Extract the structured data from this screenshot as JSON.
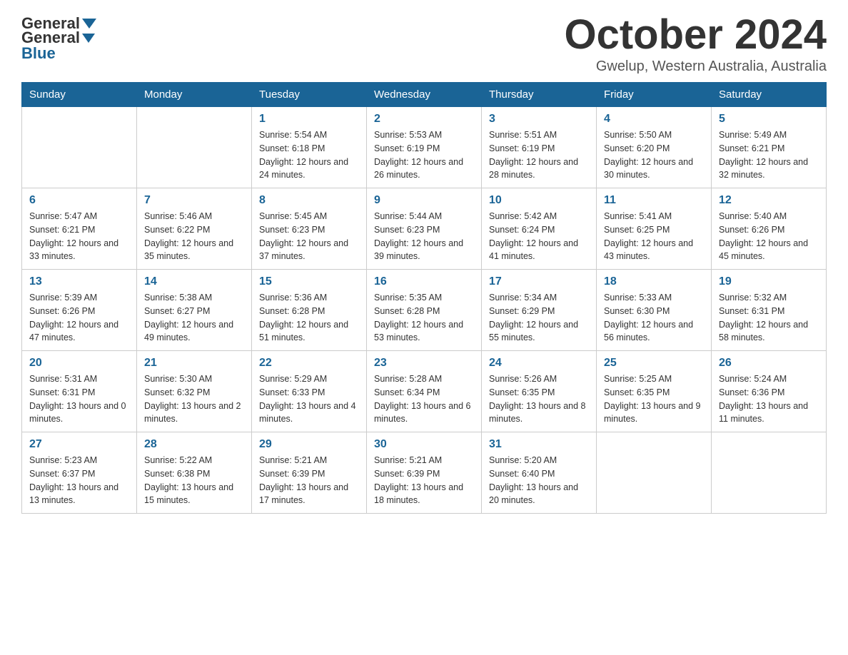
{
  "header": {
    "logo": {
      "part1": "General",
      "part2": "Blue"
    },
    "title": "October 2024",
    "location": "Gwelup, Western Australia, Australia"
  },
  "weekdays": [
    "Sunday",
    "Monday",
    "Tuesday",
    "Wednesday",
    "Thursday",
    "Friday",
    "Saturday"
  ],
  "weeks": [
    [
      {
        "day": "",
        "info": ""
      },
      {
        "day": "",
        "info": ""
      },
      {
        "day": "1",
        "info": "Sunrise: 5:54 AM\nSunset: 6:18 PM\nDaylight: 12 hours\nand 24 minutes."
      },
      {
        "day": "2",
        "info": "Sunrise: 5:53 AM\nSunset: 6:19 PM\nDaylight: 12 hours\nand 26 minutes."
      },
      {
        "day": "3",
        "info": "Sunrise: 5:51 AM\nSunset: 6:19 PM\nDaylight: 12 hours\nand 28 minutes."
      },
      {
        "day": "4",
        "info": "Sunrise: 5:50 AM\nSunset: 6:20 PM\nDaylight: 12 hours\nand 30 minutes."
      },
      {
        "day": "5",
        "info": "Sunrise: 5:49 AM\nSunset: 6:21 PM\nDaylight: 12 hours\nand 32 minutes."
      }
    ],
    [
      {
        "day": "6",
        "info": "Sunrise: 5:47 AM\nSunset: 6:21 PM\nDaylight: 12 hours\nand 33 minutes."
      },
      {
        "day": "7",
        "info": "Sunrise: 5:46 AM\nSunset: 6:22 PM\nDaylight: 12 hours\nand 35 minutes."
      },
      {
        "day": "8",
        "info": "Sunrise: 5:45 AM\nSunset: 6:23 PM\nDaylight: 12 hours\nand 37 minutes."
      },
      {
        "day": "9",
        "info": "Sunrise: 5:44 AM\nSunset: 6:23 PM\nDaylight: 12 hours\nand 39 minutes."
      },
      {
        "day": "10",
        "info": "Sunrise: 5:42 AM\nSunset: 6:24 PM\nDaylight: 12 hours\nand 41 minutes."
      },
      {
        "day": "11",
        "info": "Sunrise: 5:41 AM\nSunset: 6:25 PM\nDaylight: 12 hours\nand 43 minutes."
      },
      {
        "day": "12",
        "info": "Sunrise: 5:40 AM\nSunset: 6:26 PM\nDaylight: 12 hours\nand 45 minutes."
      }
    ],
    [
      {
        "day": "13",
        "info": "Sunrise: 5:39 AM\nSunset: 6:26 PM\nDaylight: 12 hours\nand 47 minutes."
      },
      {
        "day": "14",
        "info": "Sunrise: 5:38 AM\nSunset: 6:27 PM\nDaylight: 12 hours\nand 49 minutes."
      },
      {
        "day": "15",
        "info": "Sunrise: 5:36 AM\nSunset: 6:28 PM\nDaylight: 12 hours\nand 51 minutes."
      },
      {
        "day": "16",
        "info": "Sunrise: 5:35 AM\nSunset: 6:28 PM\nDaylight: 12 hours\nand 53 minutes."
      },
      {
        "day": "17",
        "info": "Sunrise: 5:34 AM\nSunset: 6:29 PM\nDaylight: 12 hours\nand 55 minutes."
      },
      {
        "day": "18",
        "info": "Sunrise: 5:33 AM\nSunset: 6:30 PM\nDaylight: 12 hours\nand 56 minutes."
      },
      {
        "day": "19",
        "info": "Sunrise: 5:32 AM\nSunset: 6:31 PM\nDaylight: 12 hours\nand 58 minutes."
      }
    ],
    [
      {
        "day": "20",
        "info": "Sunrise: 5:31 AM\nSunset: 6:31 PM\nDaylight: 13 hours\nand 0 minutes."
      },
      {
        "day": "21",
        "info": "Sunrise: 5:30 AM\nSunset: 6:32 PM\nDaylight: 13 hours\nand 2 minutes."
      },
      {
        "day": "22",
        "info": "Sunrise: 5:29 AM\nSunset: 6:33 PM\nDaylight: 13 hours\nand 4 minutes."
      },
      {
        "day": "23",
        "info": "Sunrise: 5:28 AM\nSunset: 6:34 PM\nDaylight: 13 hours\nand 6 minutes."
      },
      {
        "day": "24",
        "info": "Sunrise: 5:26 AM\nSunset: 6:35 PM\nDaylight: 13 hours\nand 8 minutes."
      },
      {
        "day": "25",
        "info": "Sunrise: 5:25 AM\nSunset: 6:35 PM\nDaylight: 13 hours\nand 9 minutes."
      },
      {
        "day": "26",
        "info": "Sunrise: 5:24 AM\nSunset: 6:36 PM\nDaylight: 13 hours\nand 11 minutes."
      }
    ],
    [
      {
        "day": "27",
        "info": "Sunrise: 5:23 AM\nSunset: 6:37 PM\nDaylight: 13 hours\nand 13 minutes."
      },
      {
        "day": "28",
        "info": "Sunrise: 5:22 AM\nSunset: 6:38 PM\nDaylight: 13 hours\nand 15 minutes."
      },
      {
        "day": "29",
        "info": "Sunrise: 5:21 AM\nSunset: 6:39 PM\nDaylight: 13 hours\nand 17 minutes."
      },
      {
        "day": "30",
        "info": "Sunrise: 5:21 AM\nSunset: 6:39 PM\nDaylight: 13 hours\nand 18 minutes."
      },
      {
        "day": "31",
        "info": "Sunrise: 5:20 AM\nSunset: 6:40 PM\nDaylight: 13 hours\nand 20 minutes."
      },
      {
        "day": "",
        "info": ""
      },
      {
        "day": "",
        "info": ""
      }
    ]
  ]
}
